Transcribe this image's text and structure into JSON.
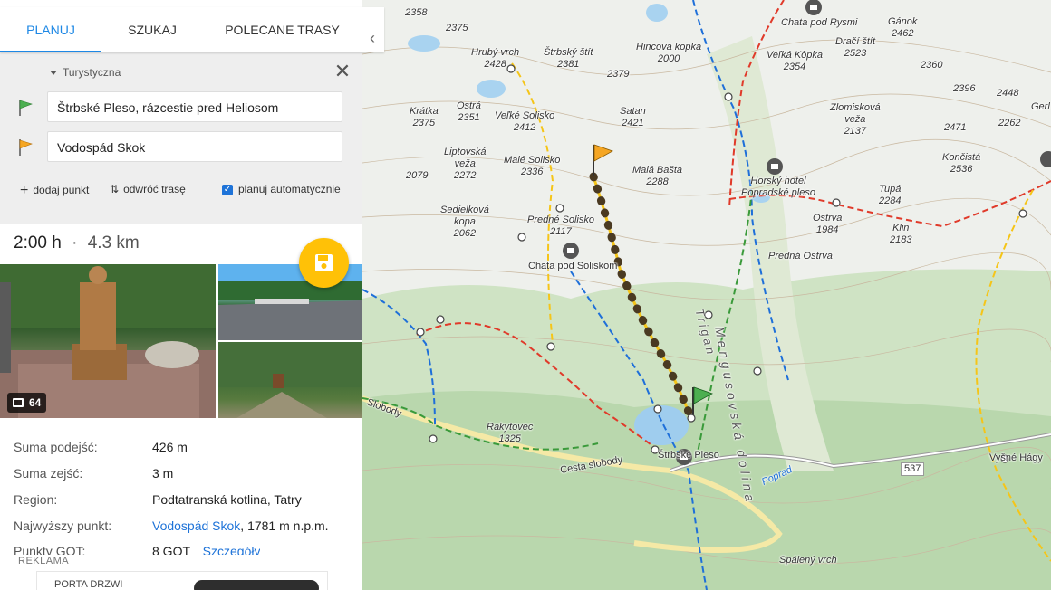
{
  "tabs": {
    "plan": "PLANUJ",
    "search": "SZUKAJ",
    "recommended": "POLECANE TRASY",
    "collapse": "‹"
  },
  "planner": {
    "route_type": "Turystyczna",
    "close": "✕",
    "from": "Štrbské Pleso, rázcestie pred Heliosom",
    "to": "Vodospád Skok",
    "add_point": "dodaj punkt",
    "reverse": "odwróć trasę",
    "auto_plan": "planuj automatycznie",
    "auto_plan_checked": true,
    "from_flag_color": "#4caf50",
    "to_flag_color": "#f5a623"
  },
  "summary": {
    "time": "2:00 h",
    "separator": "·",
    "distance": "4.3 km"
  },
  "photos": {
    "count": "64",
    "count_icon": "gallery-icon"
  },
  "save_icon": "floppy-disk-icon",
  "accent_color": "#ffc107",
  "stats": [
    {
      "label": "Suma podejść:",
      "value": "426 m"
    },
    {
      "label": "Suma zejść:",
      "value": "3 m"
    },
    {
      "label": "Region:",
      "value": "Podtatranská kotlina, Tatry"
    },
    {
      "label": "Najwyższy punkt:",
      "value_link": "Vodospád Skok",
      "value": ", 1781 m n.p.m."
    },
    {
      "label": "Punkty GOT:",
      "value": "8 GOT",
      "link": "Szczegóły"
    }
  ],
  "ad": {
    "label": "REKLAMA",
    "brand": "PORTA DRZWI"
  },
  "map": {
    "labels": [
      {
        "text": "2358"
      },
      {
        "text": "2375"
      },
      {
        "text": "Hrubý vrch\n2428"
      },
      {
        "text": "Štrbský štít\n2381"
      },
      {
        "text": "2379"
      },
      {
        "text": "Hincova kopka\n2000"
      },
      {
        "text": "Chata pod Rysmi"
      },
      {
        "text": "Veľká Kôpka\n2354"
      },
      {
        "text": "Dračí štít\n2523"
      },
      {
        "text": "Gánok\n2462"
      },
      {
        "text": "2360"
      },
      {
        "text": "2396"
      },
      {
        "text": "2448"
      },
      {
        "text": "Krátka\n2375"
      },
      {
        "text": "Ostrá\n2351"
      },
      {
        "text": "Veľké Solisko\n2412"
      },
      {
        "text": "Satan\n2421"
      },
      {
        "text": "Zlomisková\nveža\n2137"
      },
      {
        "text": "2471"
      },
      {
        "text": "2262"
      },
      {
        "text": "Gerl"
      },
      {
        "text": "Liptovská\nveža\n2272"
      },
      {
        "text": "Malé Solisko\n2336"
      },
      {
        "text": "Malá Bašta\n2288"
      },
      {
        "text": "Končistá\n2536"
      },
      {
        "text": "2079"
      },
      {
        "text": "Horský hotel\nPopradské pleso"
      },
      {
        "text": "Tupá\n2284"
      },
      {
        "text": "Sedielková\nkopa\n2062"
      },
      {
        "text": "Predné Solisko\n2117"
      },
      {
        "text": "Ostrva\n1984"
      },
      {
        "text": "Klin\n2183"
      },
      {
        "text": "Chata pod Soliskom"
      },
      {
        "text": "Predná Ostrva"
      },
      {
        "text": "Mengusovská dolina"
      },
      {
        "text": "Trigan"
      },
      {
        "text": "Rakytovec\n1325"
      },
      {
        "text": "Cesta slobody"
      },
      {
        "text": "Štrbské Pleso"
      },
      {
        "text": "Poprad"
      },
      {
        "text": "537"
      },
      {
        "text": "Vyšné Hágy"
      },
      {
        "text": "Spálený vrch"
      },
      {
        "text": "Slobody"
      }
    ],
    "route_color": "#4a3a22",
    "trail_colors": {
      "red": "#e03a2a",
      "blue": "#1e6fd9",
      "yellow": "#f5c518",
      "green": "#3a9a3a"
    }
  }
}
